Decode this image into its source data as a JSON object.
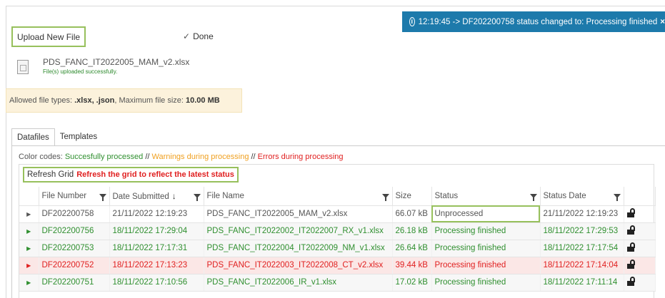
{
  "toast": {
    "icon": "info-icon",
    "message": "12:19:45 -> DF202200758 status changed to: Processing finished",
    "close": "×"
  },
  "upload": {
    "button_label": "Upload New File",
    "done_label": "Done",
    "file_name": "PDS_FANC_IT2022005_MAM_v2.xlsx",
    "file_status": "File(s) uploaded successfully."
  },
  "allowed": {
    "prefix": "Allowed file types: ",
    "types": ".xlsx, .json",
    "middle": ", Maximum file size: ",
    "size": "10.00 MB"
  },
  "tabs": [
    {
      "label": "Datafiles",
      "active": true
    },
    {
      "label": "Templates",
      "active": false
    }
  ],
  "color_codes": {
    "label": "Color codes: ",
    "success": "Succesfully processed",
    "warning": "Warnings during processing",
    "error": "Errors during processing",
    "sep": " // "
  },
  "grid": {
    "refresh_label": "Refresh Grid",
    "refresh_note": "Refresh the grid to reflect the latest status",
    "columns": [
      "File Number",
      "Date Submitted",
      "File Name",
      "Size",
      "Status",
      "Status Date"
    ],
    "rows": [
      {
        "file_number": "DF202200758",
        "date_submitted": "21/11/2022 12:19:23",
        "file_name": "PDS_FANC_IT2022005_MAM_v2.xlsx",
        "size": "66.07 kB",
        "status": "Unprocessed",
        "status_date": "21/11/2022 12:19:23",
        "state": "default"
      },
      {
        "file_number": "DF202200756",
        "date_submitted": "18/11/2022 17:29:04",
        "file_name": "PDS_FANC_IT2022002_IT2022007_RX_v1.xlsx",
        "size": "26.18 kB",
        "status": "Processing finished",
        "status_date": "18/11/2022 17:29:53",
        "state": "success"
      },
      {
        "file_number": "DF202200753",
        "date_submitted": "18/11/2022 17:17:31",
        "file_name": "PDS_FANC_IT2022004_IT2022009_NM_v1.xlsx",
        "size": "26.64 kB",
        "status": "Processing finished",
        "status_date": "18/11/2022 17:17:54",
        "state": "success"
      },
      {
        "file_number": "DF202200752",
        "date_submitted": "18/11/2022 17:13:23",
        "file_name": "PDS_FANC_IT2022003_IT2022008_CT_v2.xlsx",
        "size": "39.44 kB",
        "status": "Processing finished",
        "status_date": "18/11/2022 17:14:04",
        "state": "error"
      },
      {
        "file_number": "DF202200751",
        "date_submitted": "18/11/2022 17:10:56",
        "file_name": "PDS_FANC_IT2022006_IR_v1.xlsx",
        "size": "17.02 kB",
        "status": "Processing finished",
        "status_date": "18/11/2022 17:11:14",
        "state": "success"
      }
    ]
  },
  "colors": {
    "success": "#2f8f2f",
    "warning": "#f0a020",
    "error": "#e02020",
    "toast_bg": "#1d7aab",
    "highlight": "#97c05c"
  }
}
